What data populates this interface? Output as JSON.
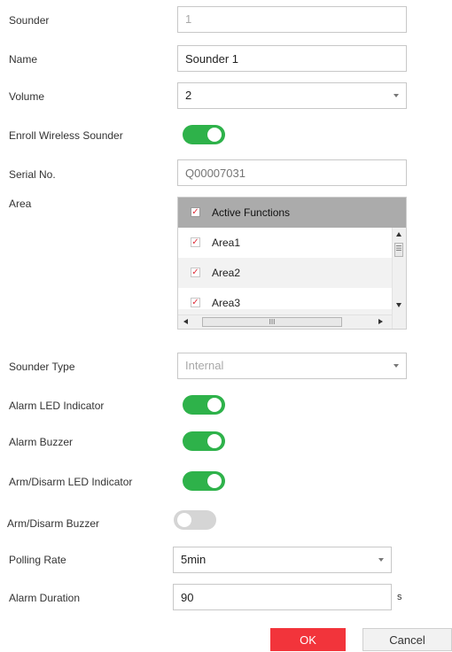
{
  "form": {
    "sounder": {
      "label": "Sounder",
      "value": "1"
    },
    "name": {
      "label": "Name",
      "value": "Sounder 1"
    },
    "volume": {
      "label": "Volume",
      "value": "2"
    },
    "enroll_wireless": {
      "label": "Enroll Wireless Sounder",
      "enabled": true
    },
    "serial_no": {
      "label": "Serial No.",
      "placeholder": "Q00007031"
    },
    "area": {
      "label": "Area",
      "header": "Active Functions",
      "items": [
        {
          "label": "Area1",
          "checked": true
        },
        {
          "label": "Area2",
          "checked": true
        },
        {
          "label": "Area3",
          "checked": true
        }
      ],
      "scroll_glyph_v": "☰",
      "scroll_glyph_h": "III"
    },
    "sounder_type": {
      "label": "Sounder Type",
      "value": "Internal"
    },
    "alarm_led": {
      "label": "Alarm LED Indicator",
      "enabled": true
    },
    "alarm_buzzer": {
      "label": "Alarm Buzzer",
      "enabled": true
    },
    "arm_disarm_led": {
      "label": "Arm/Disarm LED Indicator",
      "enabled": true
    },
    "arm_disarm_buzzer": {
      "label": "Arm/Disarm Buzzer",
      "enabled": false
    },
    "polling_rate": {
      "label": "Polling Rate",
      "value": "5min"
    },
    "alarm_duration": {
      "label": "Alarm Duration",
      "value": "90",
      "unit": "s"
    }
  },
  "buttons": {
    "ok": "OK",
    "cancel": "Cancel"
  },
  "colors": {
    "toggle_on": "#2eb24a",
    "toggle_off": "#d5d5d5",
    "ok_button": "#f2343b",
    "check_mark": "#e0303c"
  },
  "icons": {
    "check": "✓",
    "dropdown": "chevron-down-icon"
  }
}
